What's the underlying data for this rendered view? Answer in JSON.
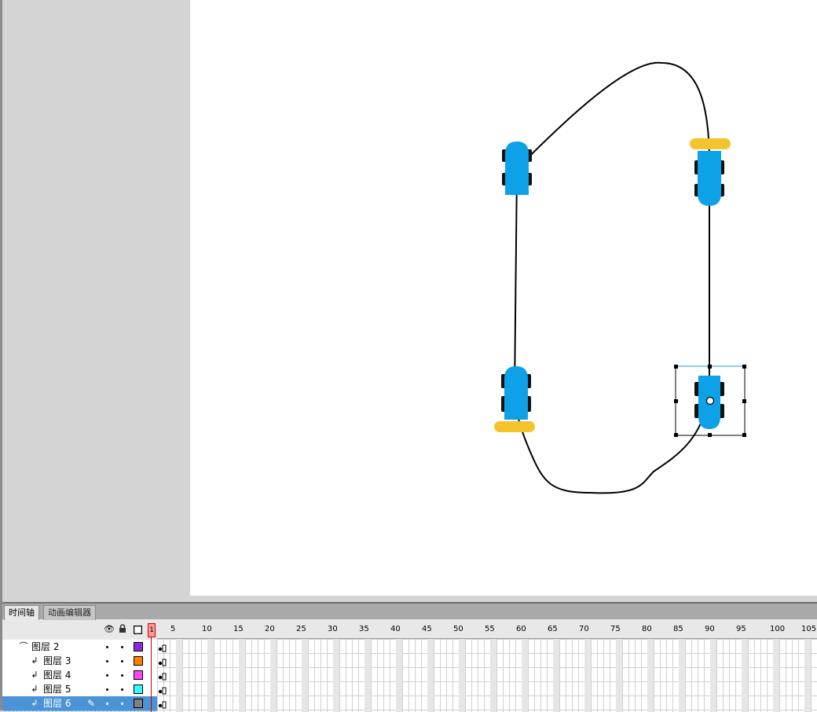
{
  "timeline_panel": {
    "tabs": [
      {
        "label": "时间轴",
        "active": true
      },
      {
        "label": "动画编辑器",
        "active": false
      }
    ],
    "header_icons": [
      "eye-icon",
      "lock-icon",
      "outline-icon"
    ],
    "current_frame": "1",
    "ruler_labels": [
      "5",
      "10",
      "15",
      "20",
      "25",
      "30",
      "35",
      "40",
      "45",
      "50",
      "55",
      "60",
      "65",
      "70",
      "75",
      "80",
      "85",
      "90",
      "95",
      "100",
      "105"
    ],
    "layers": [
      {
        "name": "图层 2",
        "type": "motion-guide",
        "color": "#8a2be2",
        "selected": false
      },
      {
        "name": "图层 3",
        "type": "guided",
        "color": "#ff7f00",
        "selected": false
      },
      {
        "name": "图层 4",
        "type": "guided",
        "color": "#ff44ff",
        "selected": false
      },
      {
        "name": "图层 5",
        "type": "guided",
        "color": "#33ffff",
        "selected": false
      },
      {
        "name": "图层 6",
        "type": "guided",
        "color": "#808080",
        "selected": true
      }
    ]
  },
  "stage": {
    "background": "#ffffff",
    "car_color": "#0da1e8",
    "bar_color": "#f5c32c",
    "path_color": "#000000"
  }
}
